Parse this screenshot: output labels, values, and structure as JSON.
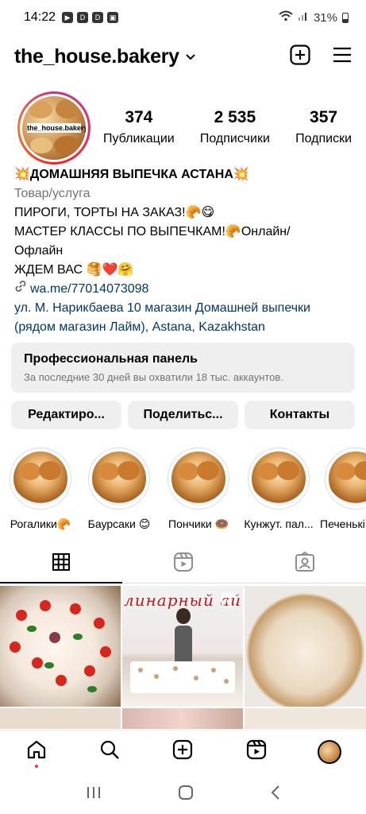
{
  "status_bar": {
    "time": "14:22",
    "battery": "31%"
  },
  "header": {
    "username": "the_house.bakery"
  },
  "profile": {
    "avatar_text": "the_house.bakery",
    "stats": [
      {
        "value": "374",
        "label": "Публикации"
      },
      {
        "value": "2 535",
        "label": "Подписчики"
      },
      {
        "value": "357",
        "label": "Подписки"
      }
    ]
  },
  "bio": {
    "name": "💥ДОМАШНЯЯ ВЫПЕЧКА АСТАНА💥",
    "category": "Товар/услуга",
    "line1": "ПИРОГИ, ТОРТЫ НА ЗАКАЗ!🥐😋",
    "line2": "МАСТЕР КЛАССЫ ПО ВЫПЕЧКАМ!🥐Онлайн/",
    "line3": "Офлайн",
    "line4": "ЖДЕМ ВАС 🥞❤️🤗",
    "link": "wa.me/77014073098",
    "address_line1": "ул. М. Нарикбаева 10 магазин Домашней выпечки",
    "address_line2": "(рядом магазин Лайм), Astana, Kazakhstan"
  },
  "pro_panel": {
    "title": "Профессиональная панель",
    "subtitle": "За последние 30 дней вы охватили 18 тыс. аккаунтов."
  },
  "buttons": {
    "edit": "Редактиро...",
    "share": "Поделитьс...",
    "contacts": "Контакты"
  },
  "highlights": [
    {
      "label": "Рогалики🥐"
    },
    {
      "label": "Баурсаки 😊"
    },
    {
      "label": "Пончики 🍩"
    },
    {
      "label": "Кунжут. пал..."
    },
    {
      "label": "Печенькі"
    }
  ],
  "posts": {
    "post2_caption": "линарный   ай"
  }
}
